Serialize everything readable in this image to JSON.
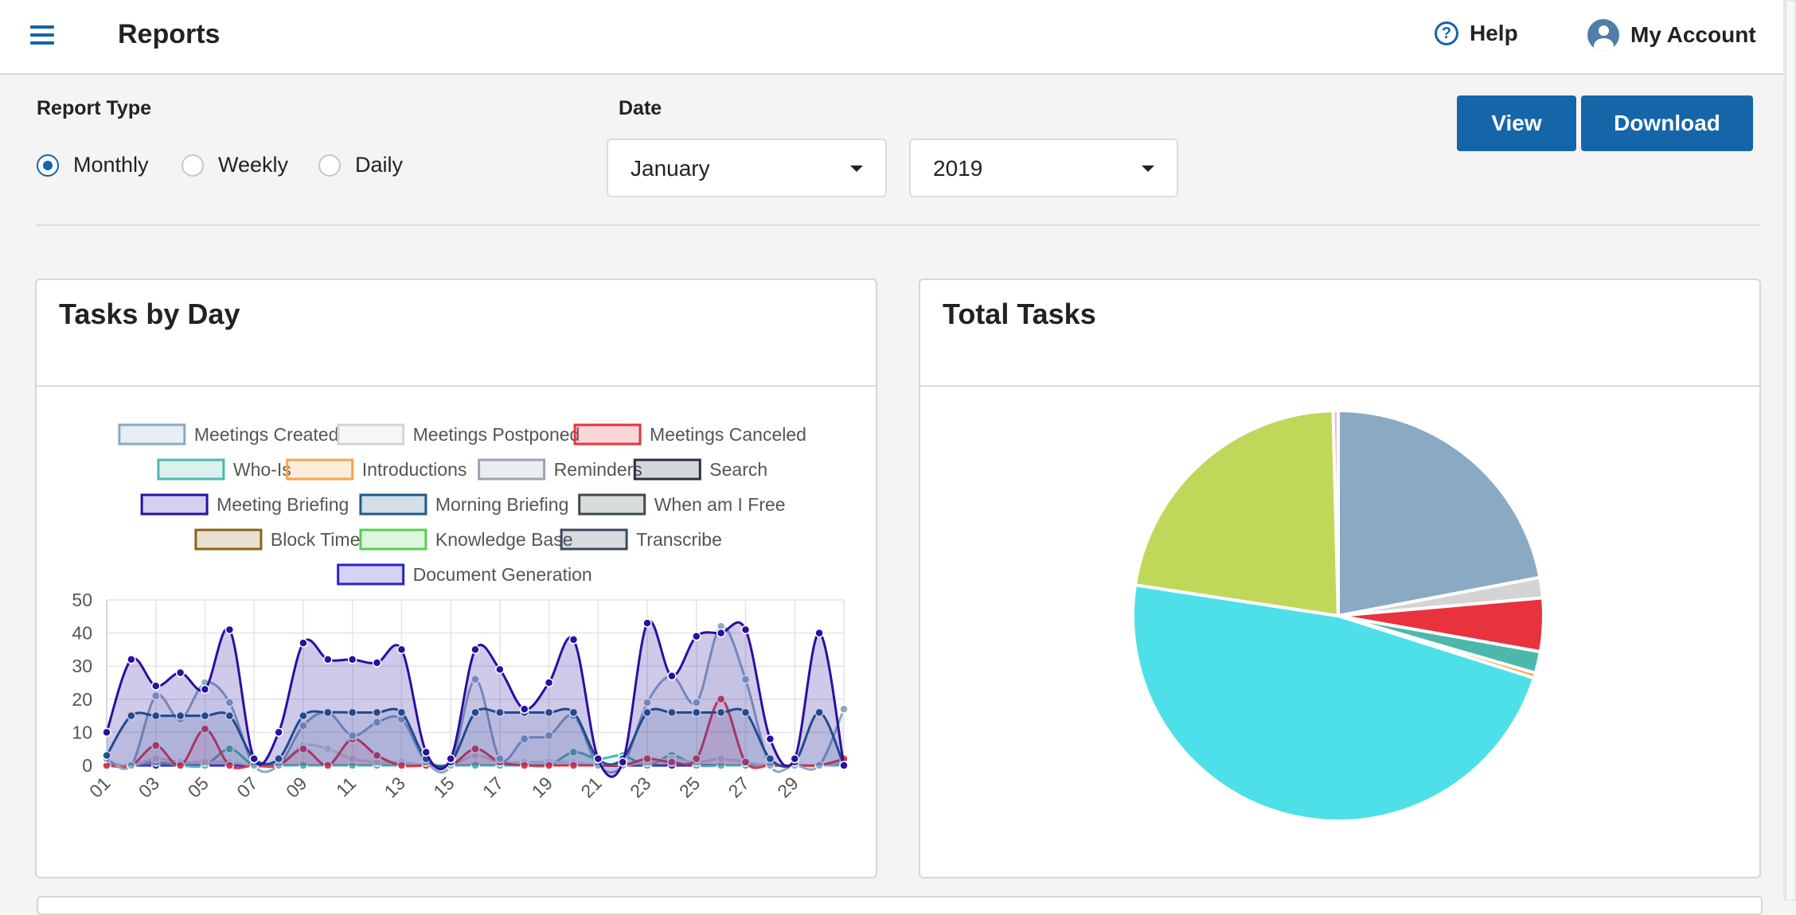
{
  "header": {
    "title": "Reports",
    "help_label": "Help",
    "account_label": "My Account",
    "accent_color": "#1565a9"
  },
  "filters": {
    "report_type_label": "Report Type",
    "options": [
      "Monthly",
      "Weekly",
      "Daily"
    ],
    "selected_option": "Monthly",
    "date_label": "Date",
    "month_value": "January",
    "year_value": "2019"
  },
  "actions": {
    "view_label": "View",
    "download_label": "Download"
  },
  "cards": {
    "tasks_by_day_title": "Tasks by Day",
    "total_tasks_title": "Total Tasks"
  },
  "chart_data": [
    {
      "type": "area",
      "title": "Tasks by Day",
      "categories": [
        "01",
        "02",
        "03",
        "04",
        "05",
        "06",
        "07",
        "08",
        "09",
        "10",
        "11",
        "12",
        "13",
        "14",
        "15",
        "16",
        "17",
        "18",
        "19",
        "20",
        "21",
        "22",
        "23",
        "24",
        "25",
        "26",
        "27",
        "28",
        "29",
        "30",
        "31"
      ],
      "x_tick_labels": [
        "01",
        "03",
        "05",
        "07",
        "09",
        "11",
        "13",
        "15",
        "17",
        "19",
        "21",
        "23",
        "25",
        "27",
        "29"
      ],
      "ylim": [
        0,
        50
      ],
      "y_ticks": [
        0,
        10,
        20,
        30,
        40,
        50
      ],
      "grid": true,
      "legend_position": "top",
      "series": [
        {
          "name": "Meetings Created",
          "color": "#8aaac3",
          "values": [
            2,
            0,
            21,
            14,
            25,
            19,
            0,
            0,
            12,
            16,
            9,
            13,
            14,
            1,
            0,
            26,
            2,
            8,
            9,
            15,
            0,
            0,
            19,
            27,
            19,
            42,
            26,
            0,
            0,
            0,
            17
          ]
        },
        {
          "name": "Meetings Postponed",
          "color": "#d4d4d4",
          "values": [
            1,
            0,
            2,
            1,
            1,
            1,
            0,
            0,
            6,
            5,
            2,
            1,
            1,
            0,
            0,
            3,
            1,
            1,
            1,
            1,
            0,
            0,
            1,
            2,
            1,
            2,
            1,
            0,
            0,
            0,
            1
          ]
        },
        {
          "name": "Meetings Canceled",
          "color": "#e8333e",
          "values": [
            0,
            0,
            6,
            0,
            11,
            0,
            0,
            0,
            5,
            0,
            8,
            3,
            0,
            0,
            0,
            5,
            1,
            0,
            0,
            0,
            0,
            0,
            2,
            1,
            2,
            20,
            1,
            0,
            0,
            0,
            2
          ]
        },
        {
          "name": "Who-Is",
          "color": "#4cb8ac",
          "values": [
            0,
            0,
            1,
            0,
            0,
            5,
            0,
            0,
            0,
            0,
            0,
            0,
            0,
            0,
            0,
            0,
            0,
            0,
            0,
            4,
            2,
            3,
            0,
            3,
            0,
            0,
            0,
            0,
            0,
            0,
            0
          ]
        },
        {
          "name": "Introductions",
          "color": "#f5a64a",
          "values": [
            0,
            0,
            0,
            0,
            0,
            0,
            0,
            0,
            0,
            0,
            0,
            0,
            0,
            0,
            0,
            0,
            0,
            0,
            0,
            0,
            0,
            0,
            0,
            0,
            0,
            0,
            0,
            0,
            0,
            0,
            0
          ]
        },
        {
          "name": "Reminders",
          "color": "#9aa3b5",
          "values": [
            0,
            0,
            0,
            0,
            0,
            0,
            0,
            0,
            0,
            0,
            0,
            0,
            0,
            0,
            0,
            0,
            0,
            0,
            0,
            0,
            0,
            0,
            0,
            0,
            0,
            0,
            0,
            0,
            0,
            0,
            0
          ]
        },
        {
          "name": "Search",
          "color": "#283142",
          "values": [
            0,
            0,
            0,
            0,
            0,
            0,
            0,
            0,
            0,
            0,
            0,
            0,
            0,
            0,
            0,
            0,
            0,
            0,
            0,
            0,
            0,
            0,
            0,
            0,
            0,
            0,
            0,
            0,
            0,
            0,
            0
          ]
        },
        {
          "name": "Meeting Briefing",
          "color": "#2a0fa0",
          "values": [
            10,
            32,
            24,
            28,
            23,
            41,
            2,
            10,
            37,
            32,
            32,
            31,
            35,
            4,
            2,
            35,
            29,
            17,
            25,
            38,
            2,
            1,
            43,
            27,
            39,
            40,
            41,
            8,
            2,
            40,
            0
          ]
        },
        {
          "name": "Morning Briefing",
          "color": "#1e5b8a",
          "values": [
            3,
            15,
            15,
            15,
            15,
            15,
            2,
            2,
            15,
            16,
            16,
            16,
            16,
            2,
            1,
            16,
            16,
            16,
            16,
            16,
            2,
            2,
            16,
            16,
            16,
            16,
            16,
            2,
            1,
            16,
            0
          ]
        },
        {
          "name": "When am I Free",
          "color": "#3c4a4a",
          "values": [
            0,
            0,
            0,
            0,
            0,
            0,
            0,
            0,
            0,
            0,
            0,
            0,
            0,
            0,
            0,
            0,
            0,
            0,
            0,
            0,
            0,
            0,
            0,
            0,
            0,
            0,
            0,
            0,
            0,
            0,
            0
          ]
        },
        {
          "name": "Block Time",
          "color": "#8c6412",
          "values": [
            0,
            0,
            0,
            0,
            0,
            0,
            0,
            0,
            0,
            0,
            0,
            0,
            0,
            0,
            0,
            0,
            0,
            0,
            0,
            0,
            0,
            0,
            0,
            0,
            0,
            0,
            0,
            0,
            0,
            0,
            0
          ]
        },
        {
          "name": "Knowledge Base",
          "color": "#55d04f",
          "values": [
            0,
            0,
            0,
            0,
            0,
            0,
            0,
            0,
            0,
            0,
            0,
            0,
            0,
            0,
            0,
            0,
            0,
            0,
            0,
            0,
            0,
            0,
            0,
            0,
            0,
            0,
            0,
            0,
            0,
            0,
            0
          ]
        },
        {
          "name": "Transcribe",
          "color": "#3a4a60",
          "values": [
            0,
            0,
            0,
            0,
            0,
            0,
            0,
            0,
            0,
            0,
            0,
            0,
            0,
            0,
            0,
            0,
            0,
            0,
            0,
            0,
            0,
            0,
            0,
            0,
            0,
            0,
            0,
            0,
            0,
            0,
            0
          ]
        },
        {
          "name": "Document Generation",
          "color": "#2b22c8",
          "values": [
            0,
            0,
            0,
            0,
            0,
            0,
            0,
            0,
            0,
            0,
            0,
            0,
            0,
            0,
            0,
            0,
            0,
            0,
            0,
            0,
            0,
            0,
            0,
            0,
            0,
            0,
            0,
            0,
            0,
            0,
            0
          ]
        }
      ]
    },
    {
      "type": "pie",
      "title": "Total Tasks",
      "slices": [
        {
          "name": "Meetings Created",
          "color": "#8aaac3",
          "value": 22.0
        },
        {
          "name": "Meetings Postponed",
          "color": "#d4d4d4",
          "value": 1.6
        },
        {
          "name": "Meetings Canceled",
          "color": "#e8333e",
          "value": 4.2
        },
        {
          "name": "Who-Is",
          "color": "#4cb8ac",
          "value": 1.7
        },
        {
          "name": "Introductions",
          "color": "#f5a64a",
          "value": 0.4
        },
        {
          "name": "Meeting Briefing",
          "color": "#4de0e8",
          "value": 47.5
        },
        {
          "name": "Morning Briefing",
          "color": "#bfd85a",
          "value": 22.2
        },
        {
          "name": "Reminders",
          "color": "#f2b6c8",
          "value": 0.4
        }
      ]
    }
  ]
}
